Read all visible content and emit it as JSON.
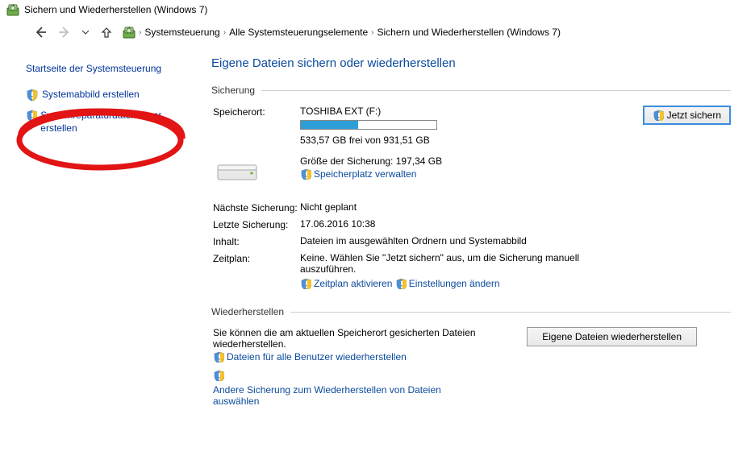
{
  "window": {
    "title": "Sichern und Wiederherstellen (Windows 7)"
  },
  "breadcrumb": {
    "root": "Systemsteuerung",
    "mid": "Alle Systemsteuerungselemente",
    "leaf": "Sichern und Wiederherstellen (Windows 7)"
  },
  "sidebar": {
    "home": "Startseite der Systemsteuerung",
    "items": [
      "Systemabbild erstellen",
      "Systemreparaturdatenträger erstellen"
    ]
  },
  "page": {
    "heading": "Eigene Dateien sichern oder wiederherstellen"
  },
  "backup": {
    "group_label": "Sicherung",
    "location_label": "Speicherort:",
    "drive_name": "TOSHIBA EXT (F:)",
    "space_free": "533,57 GB frei von 931,51 GB",
    "backup_size": "Größe der Sicherung: 197,34 GB",
    "manage_link": "Speicherplatz verwalten",
    "backup_now_btn": "Jetzt sichern",
    "next_label": "Nächste Sicherung:",
    "next_value": "Nicht geplant",
    "last_label": "Letzte Sicherung:",
    "last_value": "17.06.2016 10:38",
    "content_label": "Inhalt:",
    "content_value": "Dateien im ausgewählten Ordnern und Systemabbild",
    "schedule_label": "Zeitplan:",
    "schedule_value": "Keine. Wählen Sie \"Jetzt sichern\" aus, um die Sicherung manuell auszuführen.",
    "activate_link": "Zeitplan aktivieren",
    "settings_link": "Einstellungen ändern"
  },
  "restore": {
    "group_label": "Wiederherstellen",
    "text": "Sie können die am aktuellen Speicherort gesicherten Dateien wiederherstellen.",
    "restore_all_link": "Dateien für alle Benutzer wiederherstellen",
    "other_link": "Andere Sicherung zum Wiederherstellen von Dateien auswählen",
    "own_btn": "Eigene Dateien wiederherstellen"
  }
}
